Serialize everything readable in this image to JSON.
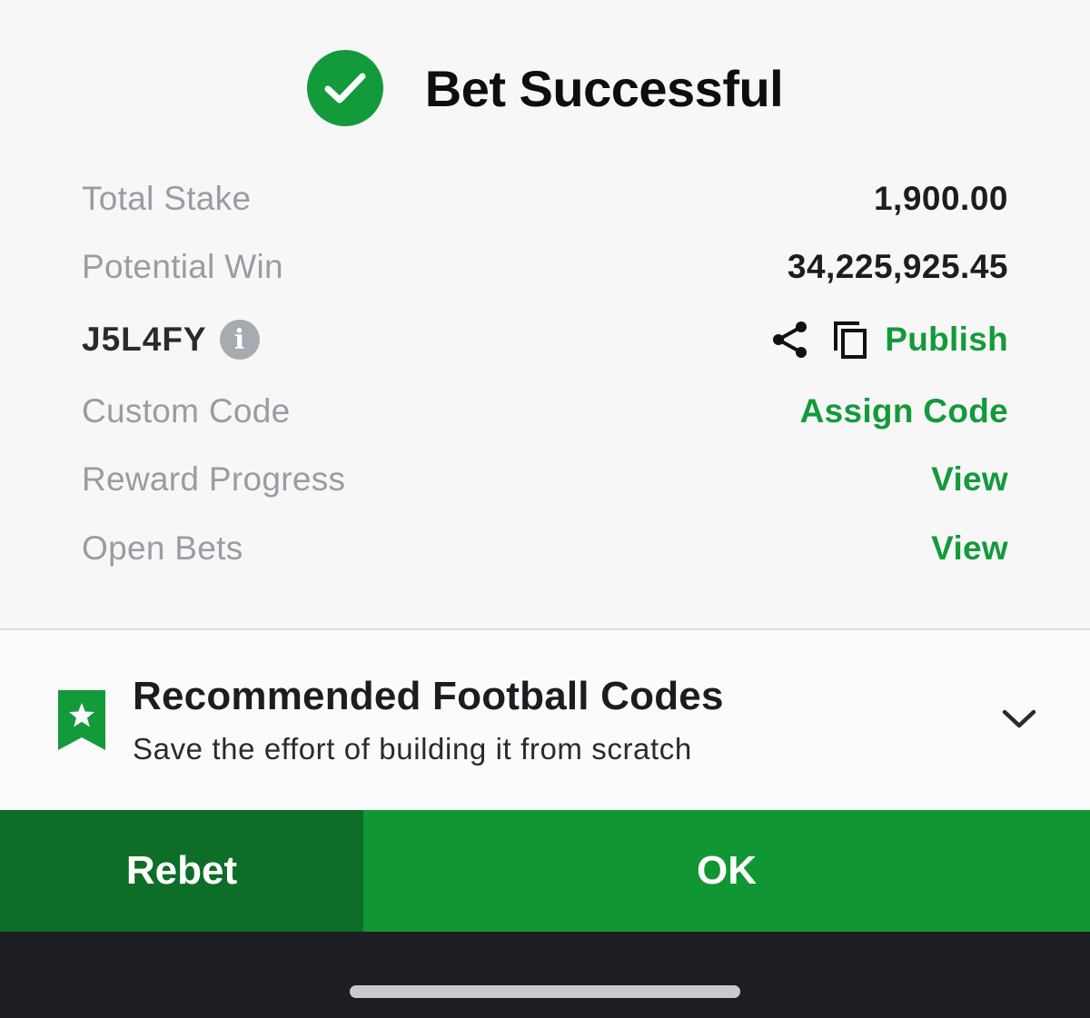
{
  "header": {
    "title": "Bet Successful",
    "status_icon": "check-circle-icon",
    "accent_color": "#139a3a"
  },
  "details": {
    "total_stake": {
      "label": "Total Stake",
      "value": "1,900.00"
    },
    "potential_win": {
      "label": "Potential Win",
      "value": "34,225,925.45"
    },
    "booking": {
      "code": "J5L4FY",
      "info_icon": "info-icon",
      "share_icon": "share-icon",
      "copy_icon": "copy-icon",
      "publish_label": "Publish"
    },
    "custom_code": {
      "label": "Custom Code",
      "action": "Assign Code"
    },
    "reward_progress": {
      "label": "Reward Progress",
      "action": "View"
    },
    "open_bets": {
      "label": "Open Bets",
      "action": "View"
    }
  },
  "recommended": {
    "title": "Recommended Football Codes",
    "subtitle": "Save the effort of building it from scratch",
    "icon": "bookmark-star-icon",
    "toggle_icon": "chevron-down-icon"
  },
  "actions": {
    "rebet_label": "Rebet",
    "ok_label": "OK",
    "rebet_color": "#0d6e27",
    "ok_color": "#119634"
  }
}
